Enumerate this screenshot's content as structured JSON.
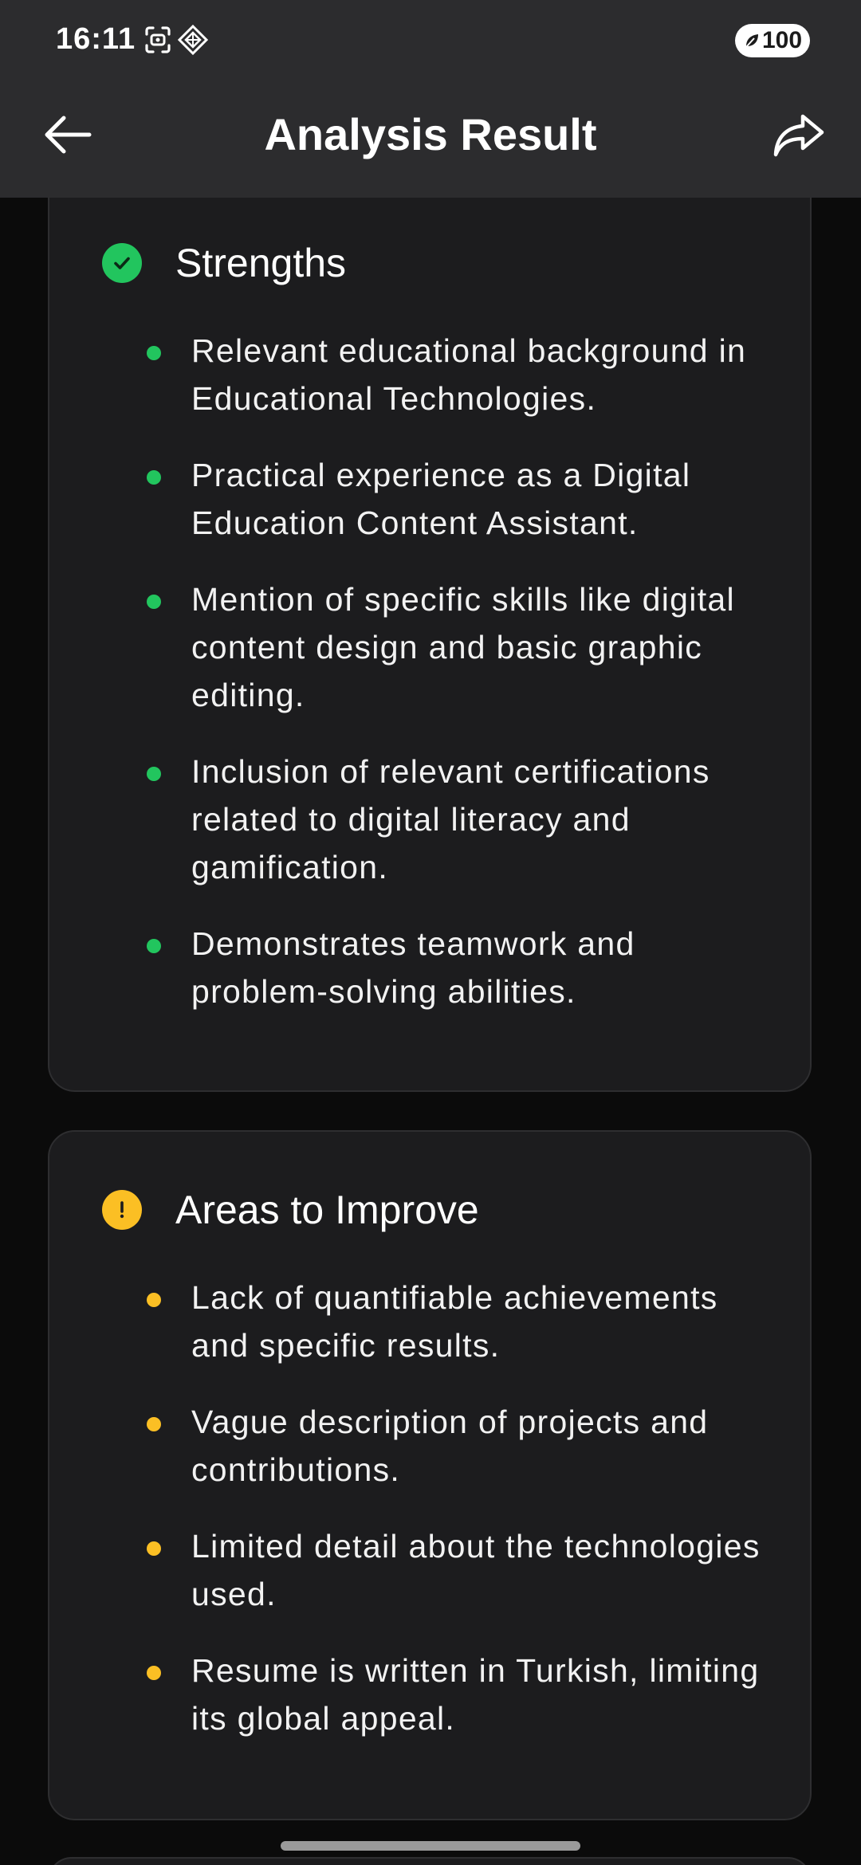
{
  "status_bar": {
    "time": "16:11",
    "battery": "100",
    "icons": [
      "screenshot-icon",
      "diamond-app-icon",
      "leaf-battery-icon"
    ]
  },
  "header": {
    "title": "Analysis Result",
    "back_icon": "arrow-left-icon",
    "share_icon": "share-icon"
  },
  "strengths": {
    "title": "Strengths",
    "icon": "check-circle-icon",
    "accent": "#22c55e",
    "items": [
      "Relevant educational background in Educational Technologies.",
      "Practical experience as a Digital Education Content Assistant.",
      "Mention of specific skills like digital content design and basic graphic editing.",
      "Inclusion of relevant certifications related to digital literacy and gamification.",
      "Demonstrates teamwork and problem-solving abilities."
    ]
  },
  "improve": {
    "title": "Areas to Improve",
    "icon": "exclamation-circle-icon",
    "accent": "#fbbf24",
    "items": [
      "Lack of quantifiable achievements and specific results.",
      "Vague description of projects and contributions.",
      "Limited detail about the technologies used.",
      "Resume is written in Turkish, limiting its global appeal."
    ]
  }
}
